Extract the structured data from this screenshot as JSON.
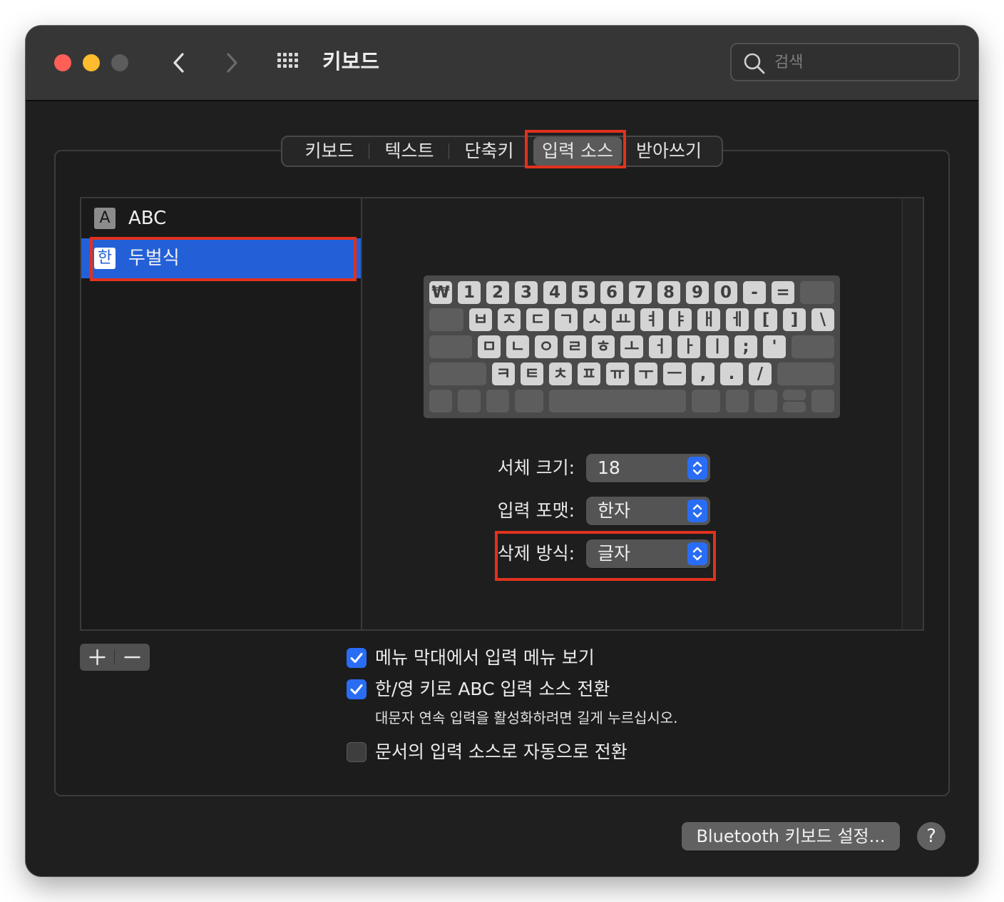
{
  "window": {
    "title": "키보드",
    "search_placeholder": "검색"
  },
  "tabs": [
    {
      "label": "키보드",
      "active": false
    },
    {
      "label": "텍스트",
      "active": false
    },
    {
      "label": "단축키",
      "active": false
    },
    {
      "label": "입력 소스",
      "active": true
    },
    {
      "label": "받아쓰기",
      "active": false
    }
  ],
  "input_sources": [
    {
      "icon": "A",
      "label": "ABC",
      "selected": false
    },
    {
      "icon": "한",
      "label": "두벌식",
      "selected": true
    }
  ],
  "keyboard_layout": {
    "row1": [
      "₩",
      "1",
      "2",
      "3",
      "4",
      "5",
      "6",
      "7",
      "8",
      "9",
      "0",
      "-",
      "="
    ],
    "row2": [
      "ㅂ",
      "ㅈ",
      "ㄷ",
      "ㄱ",
      "ㅅ",
      "ㅛ",
      "ㅕ",
      "ㅑ",
      "ㅐ",
      "ㅔ",
      "[",
      "]",
      "\\"
    ],
    "row3": [
      "ㅁ",
      "ㄴ",
      "ㅇ",
      "ㄹ",
      "ㅎ",
      "ㅗ",
      "ㅓ",
      "ㅏ",
      "ㅣ",
      ";",
      "'"
    ],
    "row4": [
      "ㅋ",
      "ㅌ",
      "ㅊ",
      "ㅍ",
      "ㅠ",
      "ㅜ",
      "ㅡ",
      ",",
      ".",
      "/"
    ]
  },
  "settings": {
    "font_size": {
      "label": "서체 크기:",
      "value": "18"
    },
    "input_format": {
      "label": "입력 포맷:",
      "value": "한자"
    },
    "delete_mode": {
      "label": "삭제 방식:",
      "value": "글자"
    }
  },
  "list_controls": {
    "add": "+",
    "remove": "–"
  },
  "checkboxes": [
    {
      "label": "메뉴 막대에서 입력 메뉴 보기",
      "checked": true
    },
    {
      "label": "한/영 키로 ABC 입력 소스 전환",
      "checked": true,
      "sublabel": "대문자 연속 입력을 활성화하려면 길게 누르십시오."
    },
    {
      "label": "문서의 입력 소스로 자동으로 전환",
      "checked": false
    }
  ],
  "footer": {
    "bluetooth_button": "Bluetooth 키보드 설정...",
    "help_button": "?"
  },
  "colors": {
    "accent": "#2a6df5",
    "selection": "#2360d8",
    "annotation": "#e0321e"
  }
}
